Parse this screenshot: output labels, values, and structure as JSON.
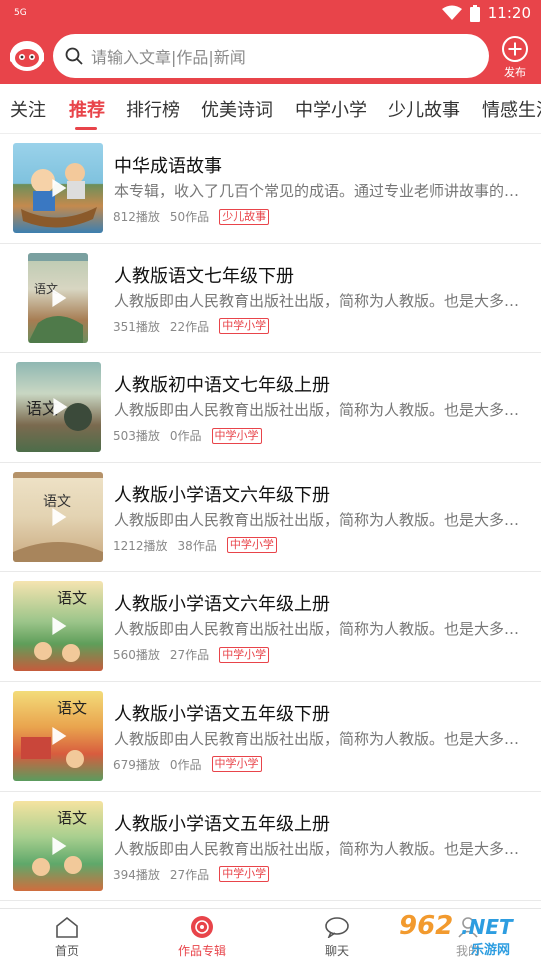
{
  "status": {
    "signal": "5G",
    "time": "11:20"
  },
  "header": {
    "search_placeholder": "请输入文章|作品|新闻",
    "publish_label": "发布"
  },
  "tabs": [
    "关注",
    "推荐",
    "排行榜",
    "优美诗词",
    "中学小学",
    "少儿故事",
    "情感生活"
  ],
  "active_tab_index": 1,
  "items": [
    {
      "title": "中华成语故事",
      "desc": "本专辑，收入了几百个常见的成语。通过专业老师讲故事的方式",
      "plays": "812播放",
      "works": "50作品",
      "tag": "少儿故事"
    },
    {
      "title": "人教版语文七年级下册",
      "desc": "人教版即由人民教育出版社出版，简称为人教版。也是大多数学校使用",
      "plays": "351播放",
      "works": "22作品",
      "tag": "中学小学"
    },
    {
      "title": "人教版初中语文七年级上册",
      "desc": "人教版即由人民教育出版社出版，简称为人教版。也是大多数学校使用",
      "plays": "503播放",
      "works": "0作品",
      "tag": "中学小学"
    },
    {
      "title": "人教版小学语文六年级下册",
      "desc": "人教版即由人民教育出版社出版，简称为人教版。也是大多数学校使用",
      "plays": "1212播放",
      "works": "38作品",
      "tag": "中学小学"
    },
    {
      "title": "人教版小学语文六年级上册",
      "desc": "人教版即由人民教育出版社出版，简称为人教版。也是大多数学校使用",
      "plays": "560播放",
      "works": "27作品",
      "tag": "中学小学"
    },
    {
      "title": "人教版小学语文五年级下册",
      "desc": "人教版即由人民教育出版社出版，简称为人教版。也是大多数学校使用",
      "plays": "679播放",
      "works": "0作品",
      "tag": "中学小学"
    },
    {
      "title": "人教版小学语文五年级上册",
      "desc": "人教版即由人民教育出版社出版，简称为人教版。也是大多数学校使用",
      "plays": "394播放",
      "works": "27作品",
      "tag": "中学小学"
    }
  ],
  "bottom_nav": [
    {
      "label": "首页",
      "icon": "home-icon"
    },
    {
      "label": "作品专辑",
      "icon": "album-disc-icon"
    },
    {
      "label": "聊天",
      "icon": "chat-bubble-icon"
    },
    {
      "label": "我的",
      "icon": "profile-icon"
    }
  ],
  "active_nav_index": 1,
  "watermark": {
    "number": "962",
    "domain": ".NET",
    "site_name": "乐游网"
  },
  "colors": {
    "accent": "#e8444a",
    "text": "#111111",
    "muted": "#777777"
  }
}
